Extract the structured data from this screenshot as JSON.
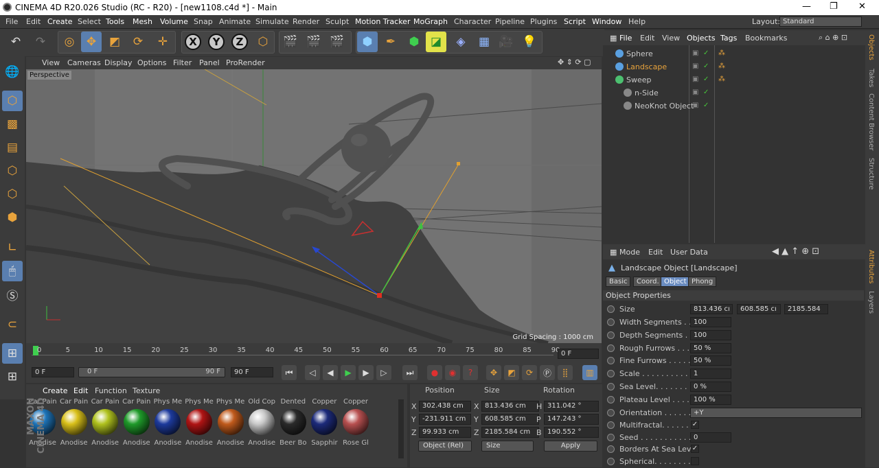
{
  "window": {
    "title": "CINEMA 4D R20.026 Studio (RC - R20) - [new1108.c4d *] - Main",
    "controls": [
      "—",
      "❐",
      "✕"
    ]
  },
  "menubar": {
    "items": [
      "File",
      "Edit",
      "Create",
      "Select",
      "Tools",
      "Mesh",
      "Volume",
      "Snap",
      "Animate",
      "Simulate",
      "Render",
      "Sculpt",
      "Motion Tracker",
      "MoGraph",
      "Character",
      "Pipeline",
      "Plugins",
      "Script",
      "Window",
      "Help"
    ],
    "layout_label": "Layout:",
    "layout_value": "Standard"
  },
  "toolbar": {
    "axis_buttons": [
      "X",
      "Y",
      "Z"
    ]
  },
  "viewport": {
    "menu": [
      "View",
      "Cameras",
      "Display",
      "Options",
      "Filter",
      "Panel",
      "ProRender"
    ],
    "label": "Perspective",
    "grid_spacing": "Grid Spacing : 1000 cm"
  },
  "timeline": {
    "ticks": [
      "0",
      "5",
      "10",
      "15",
      "20",
      "25",
      "30",
      "35",
      "40",
      "45",
      "50",
      "55",
      "60",
      "65",
      "70",
      "75",
      "80",
      "85",
      "90"
    ],
    "current_frame": "0 F",
    "start_frame": "0 F",
    "range_start": "0 F",
    "range_end": "90 F",
    "end_frame": "90 F"
  },
  "materials": {
    "menu": [
      "Create",
      "Edit",
      "Function",
      "Texture"
    ],
    "row1": [
      {
        "top": "Car Pain",
        "name": "Anodise",
        "color": "#1e74b8"
      },
      {
        "top": "Car Pain",
        "name": "Anodise",
        "color": "#d9c01a"
      },
      {
        "top": "Car Pain",
        "name": "Anodise",
        "color": "#b0c21e"
      },
      {
        "top": "Car Pain",
        "name": "Anodise",
        "color": "#1f9a2a"
      },
      {
        "top": "Phys Me",
        "name": "Anodise",
        "color": "#1d3a9c"
      },
      {
        "top": "Phys Me",
        "name": "Anodise",
        "color": "#b01414"
      },
      {
        "top": "Phys Me",
        "name": "Anodise",
        "color": "#c05a1c"
      },
      {
        "top": "Old Cop",
        "name": "Anodise",
        "color": "#c9c9c9"
      },
      {
        "top": "Dented",
        "name": "Beer Bo",
        "color": "#2a2a2a"
      },
      {
        "top": "Copper",
        "name": "Sapphir",
        "color": "#1c2a7a"
      },
      {
        "top": "Copper",
        "name": "Rose Gl",
        "color": "#b85050"
      }
    ]
  },
  "coords": {
    "headers": [
      "Position",
      "Size",
      "Rotation"
    ],
    "rows": [
      {
        "axis": "X",
        "pos": "302.438 cm",
        "saxis": "X",
        "size": "813.436 cm",
        "raxis": "H",
        "rot": "311.042 °"
      },
      {
        "axis": "Y",
        "pos": "-231.911 cm",
        "saxis": "Y",
        "size": "608.585 cm",
        "raxis": "P",
        "rot": "147.243 °"
      },
      {
        "axis": "Z",
        "pos": "99.933 cm",
        "saxis": "Z",
        "size": "2185.584 cm",
        "raxis": "B",
        "rot": "190.552 °"
      }
    ],
    "mode": "Object (Rel)",
    "size_mode": "Size",
    "apply": "Apply"
  },
  "objects": {
    "menu": [
      "File",
      "Edit",
      "View",
      "Objects",
      "Tags",
      "Bookmarks"
    ],
    "items": [
      {
        "name": "Sphere",
        "color": "#5aa0e0",
        "active": false
      },
      {
        "name": "Landscape",
        "color": "#5aa0e0",
        "active": true
      },
      {
        "name": "Sweep",
        "color": "#4cc070",
        "active": false
      },
      {
        "name": "n-Side",
        "color": "#888888",
        "active": false
      },
      {
        "name": "NeoKnot Object",
        "color": "#888888",
        "active": false
      }
    ]
  },
  "attributes": {
    "menu": [
      "Mode",
      "Edit",
      "User Data"
    ],
    "object_title": "Landscape Object [Landscape]",
    "tabs": [
      "Basic",
      "Coord.",
      "Object",
      "Phong"
    ],
    "section": "Object Properties",
    "size_label": "Size",
    "size_values": [
      "813.436 cı",
      "608.585 cı",
      "2185.584"
    ],
    "props": [
      {
        "label": "Width Segments . . .",
        "value": "100"
      },
      {
        "label": "Depth Segments . . .",
        "value": "100"
      },
      {
        "label": "Rough Furrows . . . .",
        "value": "50 %"
      },
      {
        "label": "Fine Furrows . . . . .",
        "value": "50 %"
      },
      {
        "label": "Scale . . . . . . . . . . . .",
        "value": "1"
      },
      {
        "label": "Sea Level. . . . . . . .",
        "value": "0 %"
      },
      {
        "label": "Plateau Level . . . . .",
        "value": "100 %"
      },
      {
        "label": "Orientation . . . . . . .",
        "value": "+Y"
      }
    ],
    "checks": [
      {
        "label": "Multifractal. . . . . . .",
        "value": "✓"
      },
      {
        "label": "Seed . . . . . . . . . . . .",
        "value": "0"
      },
      {
        "label": "Borders At Sea Level",
        "value": "✓"
      },
      {
        "label": "Spherical. . . . . . . . .",
        "value": ""
      }
    ]
  },
  "right_tabs": [
    "Objects",
    "Takes",
    "Content Browser",
    "Structure",
    "Attributes",
    "Layers"
  ],
  "brand": "MAXON CINEMA 4D"
}
